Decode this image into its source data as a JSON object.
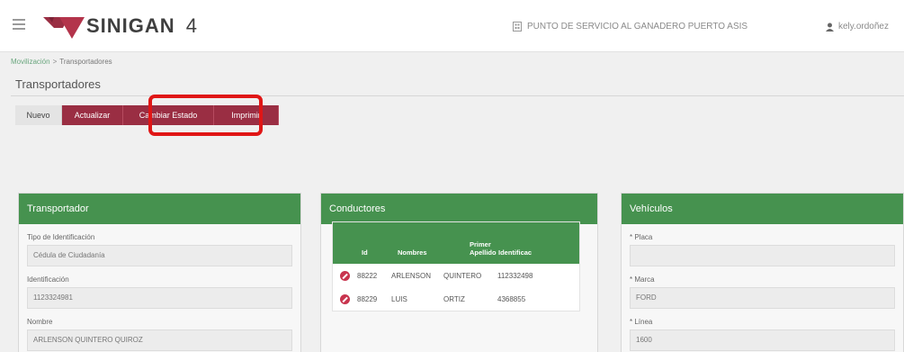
{
  "header": {
    "brand": "SINIGAN",
    "version": "4",
    "service_point": "PUNTO DE SERVICIO AL GANADERO PUERTO ASIS",
    "user": "kely.ordoñez"
  },
  "breadcrumb": {
    "parent": "Movilización",
    "separator": ">",
    "current": "Transportadores"
  },
  "page": {
    "title": "Transportadores"
  },
  "toolbar": {
    "nuevo": "Nuevo",
    "actualizar": "Actualizar",
    "cambiar_estado": "Cambiar Estado",
    "imprimir": "Imprimir"
  },
  "transportador": {
    "title": "Transportador",
    "tipo_label": "Tipo de Identificación",
    "tipo_value": "Cédula de Ciudadanía",
    "ident_label": "Identificación",
    "ident_value": "1123324981",
    "nombre_label": "Nombre",
    "nombre_value": "ARLENSON QUINTERO QUIROZ"
  },
  "conductores": {
    "title": "Conductores",
    "columns": {
      "id": "Id",
      "nombres": "Nombres",
      "apellido_1": "Primer",
      "apellido_2": "Apellido",
      "identificacion": "Identificac"
    },
    "rows": [
      {
        "id": "88222",
        "nombres": "ARLENSON",
        "apellido": "QUINTERO",
        "identificacion": "112332498"
      },
      {
        "id": "88229",
        "nombres": "LUIS",
        "apellido": "ORTIZ",
        "identificacion": "4368855"
      }
    ]
  },
  "vehiculos": {
    "title": "Vehículos",
    "required_mark": "*",
    "placa_label": "Placa",
    "placa_value": "",
    "marca_label": "Marca",
    "marca_value": "FORD",
    "linea_label": "Línea",
    "linea_value": "1600"
  },
  "colors": {
    "primary_green": "#46924f",
    "button_maroon": "#9a2e43",
    "highlight_red": "#e01616"
  }
}
